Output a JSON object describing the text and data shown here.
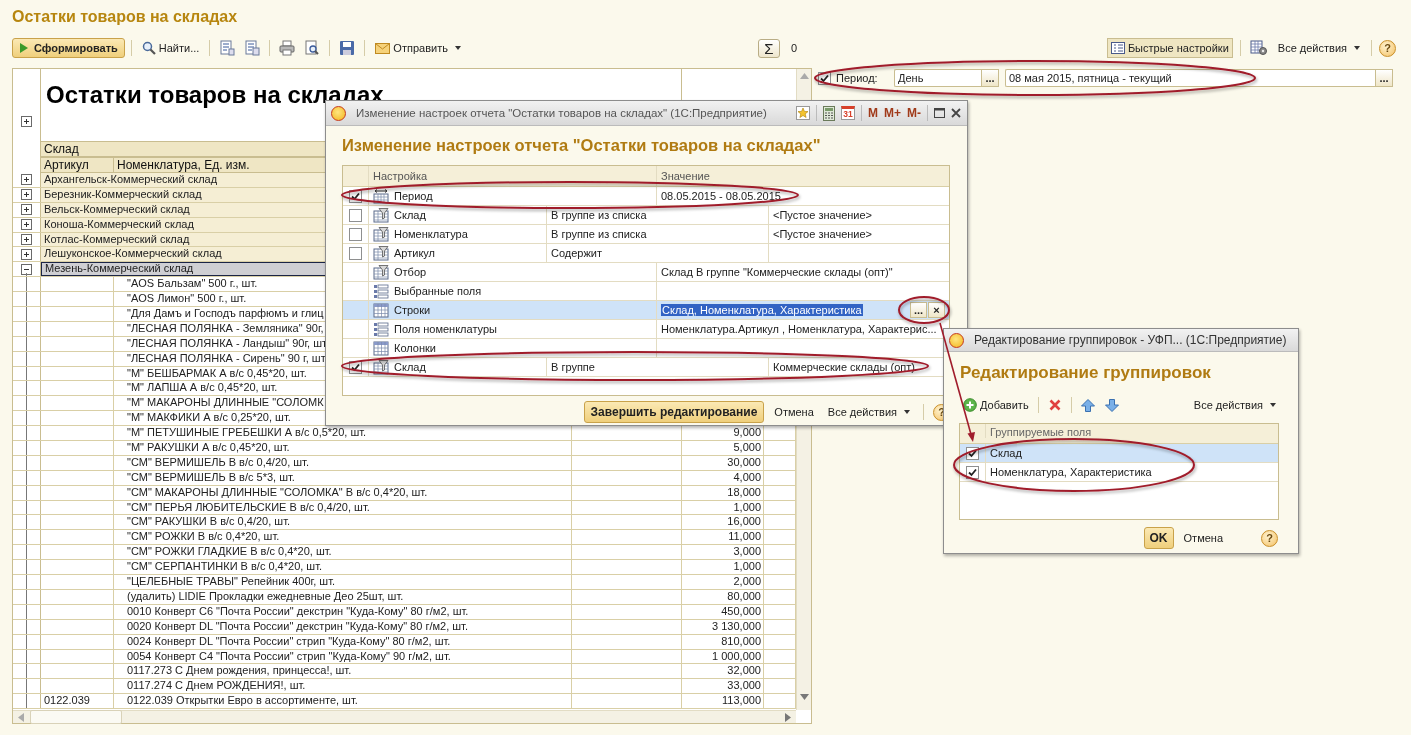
{
  "page_title": "Остатки товаров на складах",
  "toolbar": {
    "generate": "Сформировать",
    "find": "Найти...",
    "send": "Отправить",
    "sum_symbol": "Σ",
    "sum_value": "0",
    "quick_settings": {
      "label": "Быстрые настройки",
      "pressed": true
    },
    "all_actions": "Все действия",
    "help": "?"
  },
  "period_panel": {
    "checked": true,
    "label": "Период:",
    "fields": [
      {
        "value": "День",
        "button": "..."
      },
      {
        "value": "08 мая 2015, пятница - текущий",
        "button": "..."
      }
    ]
  },
  "report": {
    "title": "Остатки товаров на складах",
    "header": {
      "expanded": false,
      "group": "Склад",
      "columns": [
        "Артикул",
        "Номенклатура, Ед. изм."
      ]
    },
    "groups": [
      {
        "name": "Архангельск-Коммерческий склад",
        "expanded": false,
        "selected": false
      },
      {
        "name": "Березник-Коммерческий склад",
        "expanded": false,
        "selected": false
      },
      {
        "name": "Вельск-Коммерческий склад",
        "expanded": false,
        "selected": false
      },
      {
        "name": "Коноша-Коммерческий склад",
        "expanded": false,
        "selected": false
      },
      {
        "name": "Котлас-Коммерческий склад",
        "expanded": false,
        "selected": false
      },
      {
        "name": "Лешуконское-Коммерческий склад",
        "expanded": false,
        "selected": false
      },
      {
        "name": "Мезень-Коммерческий склад",
        "expanded": true,
        "selected": true,
        "children": [
          {
            "name": "\"AOS Бальзам\" 500 г., шт."
          },
          {
            "name": "\"AOS Лимон\" 500 г., шт."
          },
          {
            "name": "\"Для Дамъ и Господъ парфюмъ и глиц"
          },
          {
            "name": "\"ЛЕСНАЯ ПОЛЯНКА - Земляника\" 90г,"
          },
          {
            "name": "\"ЛЕСНАЯ ПОЛЯНКА - Ландыш\" 90г, шт"
          },
          {
            "name": "\"ЛЕСНАЯ ПОЛЯНКА - Сирень\" 90 г, шт"
          },
          {
            "name": "\"М\" БЕШБАРМАК А в/с 0,45*20, шт."
          },
          {
            "name": "\"М\" ЛАПША А в/с 0,45*20, шт."
          },
          {
            "name": "\"М\" МАКАРОНЫ ДЛИННЫЕ \"СОЛОМК"
          },
          {
            "name": "\"М\" МАКФИКИ А в/с 0,25*20, шт."
          },
          {
            "name": "\"М\" ПЕТУШИНЫЕ ГРЕБЕШКИ А в/с 0,5*20, шт.",
            "quantity": "9,000"
          },
          {
            "name": "\"М\" РАКУШКИ А в/с 0,45*20, шт.",
            "quantity": "5,000"
          },
          {
            "name": "\"СМ\" ВЕРМИШЕЛЬ В в/с 0,4/20, шт.",
            "quantity": "30,000"
          },
          {
            "name": "\"СМ\" ВЕРМИШЕЛЬ В в/с 5*3, шт.",
            "quantity": "4,000"
          },
          {
            "name": "\"СМ\" МАКАРОНЫ ДЛИННЫЕ \"СОЛОМКА\" В в/с 0,4*20, шт.",
            "quantity": "18,000"
          },
          {
            "name": "\"СМ\" ПЕРЬЯ ЛЮБИТЕЛЬСКИЕ В в/с 0,4/20, шт.",
            "quantity": "1,000"
          },
          {
            "name": "\"СМ\" РАКУШКИ В в/с 0,4/20, шт.",
            "quantity": "16,000"
          },
          {
            "name": "\"СМ\" РОЖКИ В в/с 0,4*20, шт.",
            "quantity": "11,000"
          },
          {
            "name": "\"СМ\" РОЖКИ ГЛАДКИЕ В в/с 0,4*20, шт.",
            "quantity": "3,000"
          },
          {
            "name": "\"СМ\" СЕРПАНТИНКИ В в/с 0,4*20, шт.",
            "quantity": "1,000"
          },
          {
            "name": "\"ЦЕЛЕБНЫЕ ТРАВЫ\" Репейник 400г, шт.",
            "quantity": "2,000"
          },
          {
            "name": "(удалить) LIDIE Прокладки ежедневные Део 25шт, шт.",
            "quantity": "80,000"
          },
          {
            "name": "0010 Конверт С6 \"Почта России\" декстрин \"Куда-Кому\" 80 г/м2, шт.",
            "quantity": "450,000"
          },
          {
            "name": "0020 Конверт DL \"Почта России\" декстрин \"Куда-Кому\" 80 г/м2, шт.",
            "quantity": "3 130,000"
          },
          {
            "name": "0024 Конверт DL \"Почта России\" стрип \"Куда-Кому\" 80 г/м2, шт.",
            "quantity": "810,000"
          },
          {
            "name": "0054 Конверт С4 \"Почта России\" стрип \"Куда-Кому\" 90 г/м2, шт.",
            "quantity": "1 000,000"
          },
          {
            "name": "0117.273 С Днем рождения, принцесса!, шт.",
            "quantity": "32,000"
          },
          {
            "name": "0117.274 С Днем РОЖДЕНИЯ!, шт.",
            "quantity": "33,000"
          },
          {
            "article": "0122.039",
            "name": "0122.039 Открытки Евро в ассортименте, шт.",
            "quantity": "113,000"
          }
        ]
      }
    ]
  },
  "settings_dialog": {
    "window_title": "Изменение настроек отчета \"Остатки товаров на складах\"  (1С:Предприятие)",
    "calendar_day": "31",
    "memory_buttons": [
      "M",
      "M+",
      "M-"
    ],
    "heading": "Изменение настроек отчета \"Остатки товаров на складах\"",
    "columns": [
      "Настройка",
      "Значение"
    ],
    "rows": [
      {
        "kind": "period",
        "name": "Период",
        "value": "08.05.2015 - 08.05.2015",
        "checked": true,
        "selected": false
      },
      {
        "kind": "filter",
        "name": "Склад",
        "condition": "В группе из списка",
        "value": "<Пустое значение>",
        "checked": false,
        "selected": false
      },
      {
        "kind": "filter",
        "name": "Номенклатура",
        "condition": "В группе из списка",
        "value": "<Пустое значение>",
        "checked": false,
        "selected": false
      },
      {
        "kind": "filter",
        "name": "Артикул",
        "condition": "Содержит",
        "checked": false,
        "selected": false
      },
      {
        "kind": "selection",
        "name": "Отбор",
        "value": "Склад В группе \"Коммерческие склады (опт)\"",
        "selected": false
      },
      {
        "kind": "fields",
        "name": "Выбранные поля",
        "selected": false
      },
      {
        "kind": "grouping",
        "name": "Строки",
        "value": "Склад, Номенклатура, Характеристика",
        "selected": true,
        "buttons": [
          "...",
          "×"
        ]
      },
      {
        "kind": "fields",
        "name": "Поля номенклатуры",
        "value": "Номенклатура.Артикул , Номенклатура, Характерис...",
        "selected": false
      },
      {
        "kind": "grouping",
        "name": "Колонки",
        "selected": false
      },
      {
        "kind": "filter",
        "name": "Склад",
        "condition": "В группе",
        "value": "Коммерческие склады (опт)",
        "checked": true,
        "selected": false
      }
    ],
    "finish": "Завершить редактирование",
    "cancel": "Отмена",
    "all_actions": "Все действия",
    "help": "?"
  },
  "grouping_dialog": {
    "window_title": "Редактирование группировок - УФП...  (1С:Предприятие)",
    "heading": "Редактирование группировок",
    "add": "Добавить",
    "all_actions": "Все действия",
    "column": "Группируемые поля",
    "rows": [
      {
        "name": "Склад",
        "checked": true,
        "selected": true
      },
      {
        "name": "Номенклатура, Характеристика",
        "checked": true,
        "selected": false
      }
    ],
    "ok": "OK",
    "cancel": "Отмена",
    "help": "?"
  }
}
